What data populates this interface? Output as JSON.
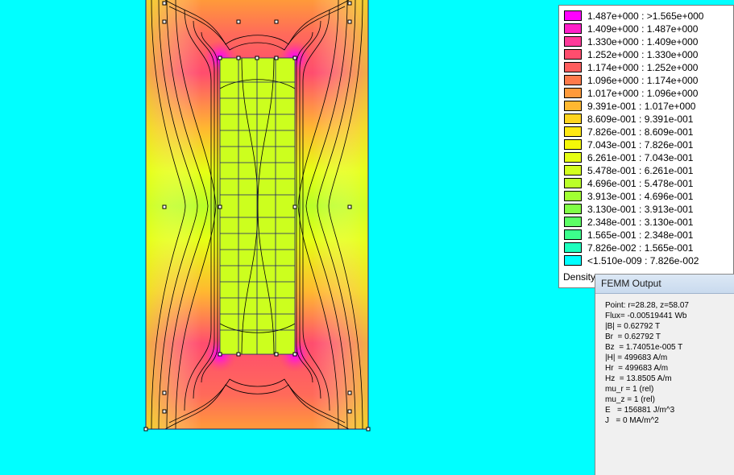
{
  "legend": {
    "entries": [
      {
        "label": "1.487e+000 : >1.565e+000",
        "color": "#ff00ff"
      },
      {
        "label": "1.409e+000 : 1.487e+000",
        "color": "#ff20c8"
      },
      {
        "label": "1.330e+000 : 1.409e+000",
        "color": "#ff3a9a"
      },
      {
        "label": "1.252e+000 : 1.330e+000",
        "color": "#ff4d6e"
      },
      {
        "label": "1.174e+000 : 1.252e+000",
        "color": "#ff5e5e"
      },
      {
        "label": "1.096e+000 : 1.174e+000",
        "color": "#ff7a4a"
      },
      {
        "label": "1.017e+000 : 1.096e+000",
        "color": "#ff9a3a"
      },
      {
        "label": "9.391e-001 : 1.017e+000",
        "color": "#ffb830"
      },
      {
        "label": "8.609e-001 : 9.391e-001",
        "color": "#ffd41e"
      },
      {
        "label": "7.826e-001 : 8.609e-001",
        "color": "#ffe814"
      },
      {
        "label": "7.043e-001 : 7.826e-001",
        "color": "#f4f808"
      },
      {
        "label": "6.261e-001 : 7.043e-001",
        "color": "#e6ff14"
      },
      {
        "label": "5.478e-001 : 6.261e-001",
        "color": "#d2ff1e"
      },
      {
        "label": "4.696e-001 : 5.478e-001",
        "color": "#baff28"
      },
      {
        "label": "3.913e-001 : 4.696e-001",
        "color": "#a0ff32"
      },
      {
        "label": "3.130e-001 : 3.913e-001",
        "color": "#80ff46"
      },
      {
        "label": "2.348e-001 : 3.130e-001",
        "color": "#5cff64"
      },
      {
        "label": "1.565e-001 : 2.348e-001",
        "color": "#3cff8c"
      },
      {
        "label": "7.826e-002 : 1.565e-001",
        "color": "#1effbe"
      },
      {
        "label": "<1.510e-009 : 7.826e-002",
        "color": "#00ffff"
      }
    ],
    "title": "Density"
  },
  "output_window": {
    "title": "FEMM Output",
    "lines": [
      "Point: r=28.28, z=58.07",
      "Flux= -0.00519441 Wb",
      "|B| = 0.62792 T",
      "Br  = 0.62792 T",
      "Bz  = 1.74051e-005 T",
      "|H| = 499683 A/m",
      "Hr  = 499683 A/m",
      "Hz  = 13.8505 A/m",
      "mu_r = 1 (rel)",
      "mu_z = 1 (rel)",
      "E   = 156881 J/m^3",
      "J   = 0 MA/m^2"
    ]
  },
  "colors": {
    "background": "#00ffff",
    "contour_line": "#000000",
    "geometry_line": "#1a1a6e"
  }
}
